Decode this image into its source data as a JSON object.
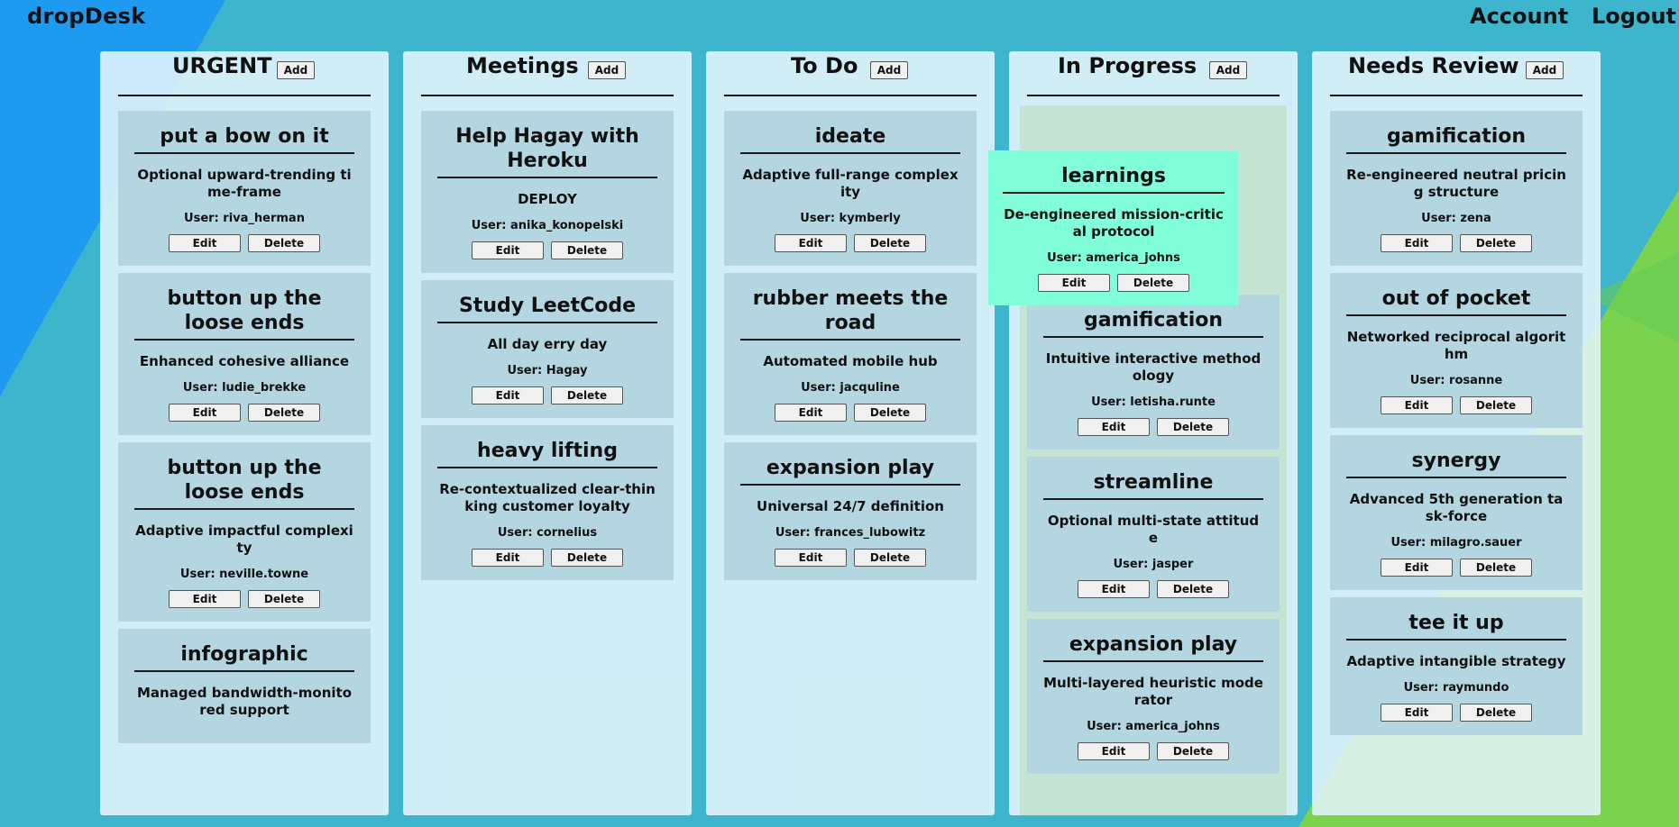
{
  "app": {
    "brand": "dropDesk",
    "nav": {
      "account": "Account",
      "logout": "Logout"
    }
  },
  "columns": [
    {
      "title": "URGENT",
      "add_label": "Add",
      "cards": [
        {
          "title": "put a bow on it",
          "desc": "Optional upward-trending time-frame",
          "user": "User: riva_herman",
          "edit": "Edit",
          "delete": "Delete"
        },
        {
          "title": "button up the loose ends",
          "desc": "Enhanced cohesive alliance",
          "user": "User: ludie_brekke",
          "edit": "Edit",
          "delete": "Delete"
        },
        {
          "title": "button up the loose ends",
          "desc": "Adaptive impactful complexity",
          "user": "User: neville.towne",
          "edit": "Edit",
          "delete": "Delete"
        },
        {
          "title": "infographic",
          "desc": "Managed bandwidth-monitored support",
          "user": "",
          "edit": "",
          "delete": ""
        }
      ]
    },
    {
      "title": "Meetings",
      "add_label": "Add",
      "cards": [
        {
          "title": "Help Hagay with Heroku",
          "desc": "DEPLOY",
          "user": "User: anika_konopelski",
          "edit": "Edit",
          "delete": "Delete"
        },
        {
          "title": "Study LeetCode",
          "desc": "All day erry day",
          "user": "User: Hagay",
          "edit": "Edit",
          "delete": "Delete"
        },
        {
          "title": "heavy lifting",
          "desc": "Re-contextualized clear-thinking customer loyalty",
          "user": "User: cornelius",
          "edit": "Edit",
          "delete": "Delete"
        }
      ]
    },
    {
      "title": "To Do",
      "add_label": "Add",
      "cards": [
        {
          "title": "ideate",
          "desc": "Adaptive full-range complexity",
          "user": "User: kymberly",
          "edit": "Edit",
          "delete": "Delete"
        },
        {
          "title": "rubber meets the road",
          "desc": "Automated mobile hub",
          "user": "User: jacquline",
          "edit": "Edit",
          "delete": "Delete"
        },
        {
          "title": "expansion play",
          "desc": "Universal 24/7 definition",
          "user": "User: frances_lubowitz",
          "edit": "Edit",
          "delete": "Delete"
        }
      ]
    },
    {
      "title": "In Progress",
      "add_label": "Add",
      "cards": [
        {
          "title": "gamification",
          "desc": "Intuitive interactive methodology",
          "user": "User: letisha.runte",
          "edit": "Edit",
          "delete": "Delete"
        },
        {
          "title": "streamline",
          "desc": "Optional multi-state attitude",
          "user": "User: jasper",
          "edit": "Edit",
          "delete": "Delete"
        },
        {
          "title": "expansion play",
          "desc": "Multi-layered heuristic moderator",
          "user": "User: america_johns",
          "edit": "Edit",
          "delete": "Delete"
        }
      ]
    },
    {
      "title": "Needs Review",
      "add_label": "Add",
      "cards": [
        {
          "title": "gamification",
          "desc": "Re-engineered neutral pricing structure",
          "user": "User: zena",
          "edit": "Edit",
          "delete": "Delete"
        },
        {
          "title": "out of pocket",
          "desc": "Networked reciprocal algorithm",
          "user": "User: rosanne",
          "edit": "Edit",
          "delete": "Delete"
        },
        {
          "title": "synergy",
          "desc": "Advanced 5th generation task-force",
          "user": "User: milagro.sauer",
          "edit": "Edit",
          "delete": "Delete"
        },
        {
          "title": "tee it up",
          "desc": "Adaptive intangible strategy",
          "user": "User: raymundo",
          "edit": "Edit",
          "delete": "Delete"
        }
      ]
    }
  ],
  "dragging": {
    "title": "learnings",
    "desc": "De-engineered mission-critical protocol",
    "user": "User: america_johns",
    "edit": "Edit",
    "delete": "Delete"
  },
  "colors": {
    "bg_blue": "#1e9bf0",
    "bg_teal": "#3db5cc",
    "bg_green": "#7bd24e",
    "card": "#b4d6e1",
    "drag_card": "#80ffd8"
  }
}
